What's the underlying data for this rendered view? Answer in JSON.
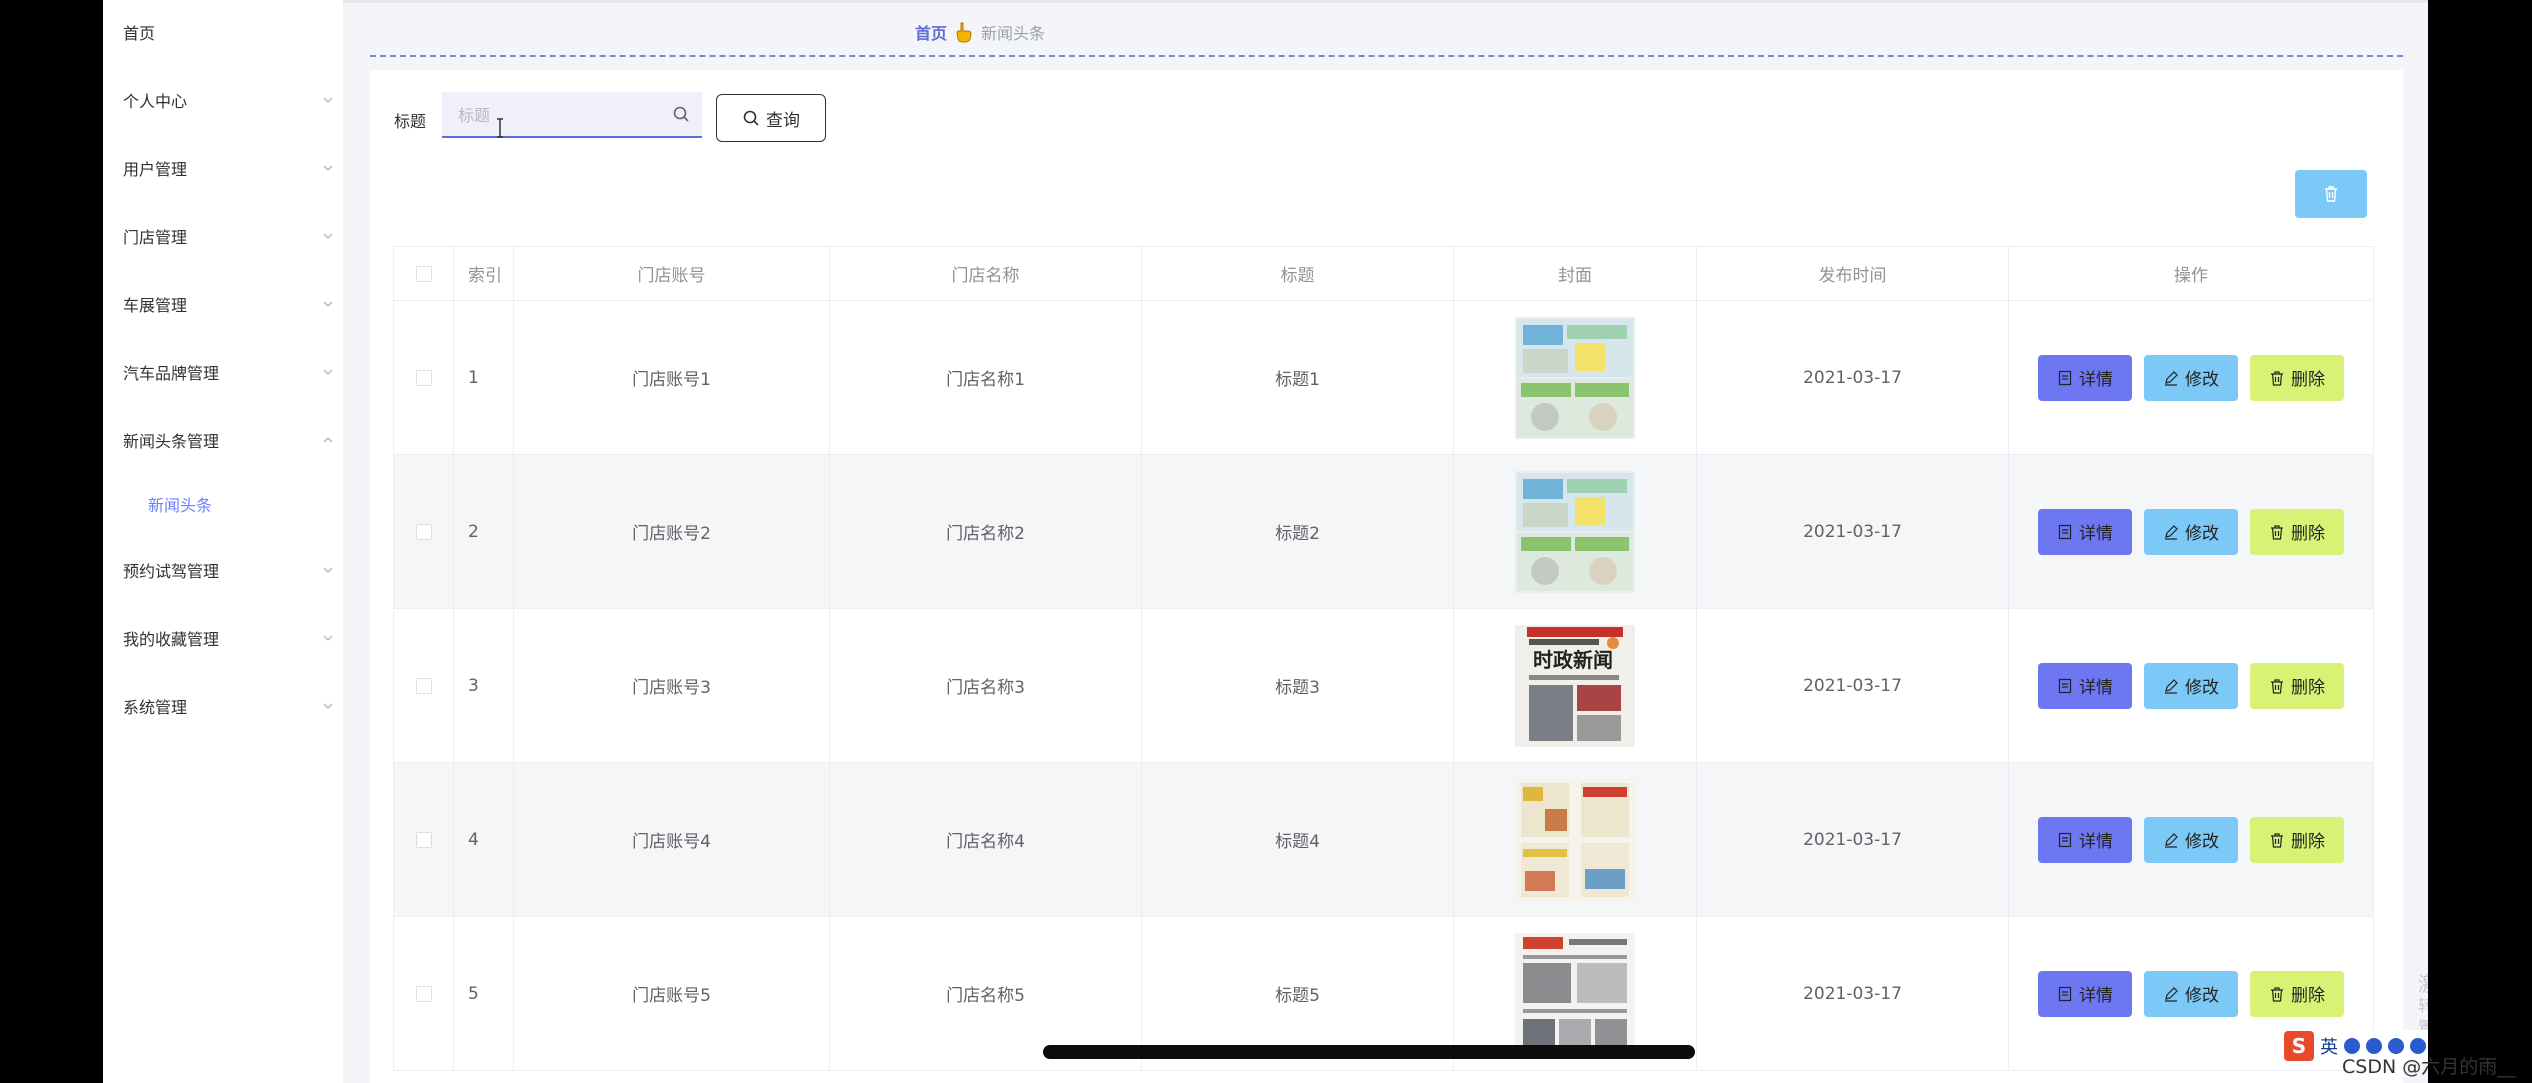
{
  "sidebar": {
    "items": [
      {
        "label": "首页",
        "has_chevron": false
      },
      {
        "label": "个人中心",
        "has_chevron": true
      },
      {
        "label": "用户管理",
        "has_chevron": true
      },
      {
        "label": "门店管理",
        "has_chevron": true
      },
      {
        "label": "车展管理",
        "has_chevron": true
      },
      {
        "label": "汽车品牌管理",
        "has_chevron": true
      },
      {
        "label": "新闻头条管理",
        "has_chevron": true,
        "expanded": true
      },
      {
        "label": "新闻头条",
        "sub": true,
        "active": true
      },
      {
        "label": "预约试驾管理",
        "has_chevron": true
      },
      {
        "label": "我的收藏管理",
        "has_chevron": true
      },
      {
        "label": "系统管理",
        "has_chevron": true
      }
    ]
  },
  "breadcrumb": {
    "home": "首页",
    "current": "新闻头条"
  },
  "search": {
    "label": "标题",
    "placeholder": "标题",
    "value": "",
    "button_label": "查询"
  },
  "table": {
    "headers": [
      "索引",
      "门店账号",
      "门店名称",
      "标题",
      "封面",
      "发布时间",
      "操作"
    ],
    "rows": [
      {
        "index": "1",
        "account": "门店账号1",
        "name": "门店名称1",
        "title": "标题1",
        "cover": "newspaper-green",
        "time": "2021-03-17"
      },
      {
        "index": "2",
        "account": "门店账号2",
        "name": "门店名称2",
        "title": "标题2",
        "cover": "newspaper-green",
        "time": "2021-03-17"
      },
      {
        "index": "3",
        "account": "门店账号3",
        "name": "门店名称3",
        "title": "标题3",
        "cover": "newspaper-red",
        "time": "2021-03-17"
      },
      {
        "index": "4",
        "account": "门店账号4",
        "name": "门店名称4",
        "title": "标题4",
        "cover": "newspaper-yellow",
        "time": "2021-03-17"
      },
      {
        "index": "5",
        "account": "门店账号5",
        "name": "门店名称5",
        "title": "标题5",
        "cover": "newspaper-gray",
        "time": "2021-03-17"
      }
    ],
    "actions": {
      "detail": "详情",
      "edit": "修改",
      "delete": "删除"
    },
    "cover3_headline": "时政新闻"
  },
  "overlay": {
    "watermark_line1": "激活 W",
    "watermark_line2": "转到\"设置\"以激活 Windows。",
    "tray_lang": "英",
    "csdn": "CSDN @六月的雨__"
  },
  "colors": {
    "accent": "#5f6bd8",
    "detail_btn": "#6d77f2",
    "edit_btn": "#7cc8f7",
    "delete_btn": "#d7f274"
  }
}
